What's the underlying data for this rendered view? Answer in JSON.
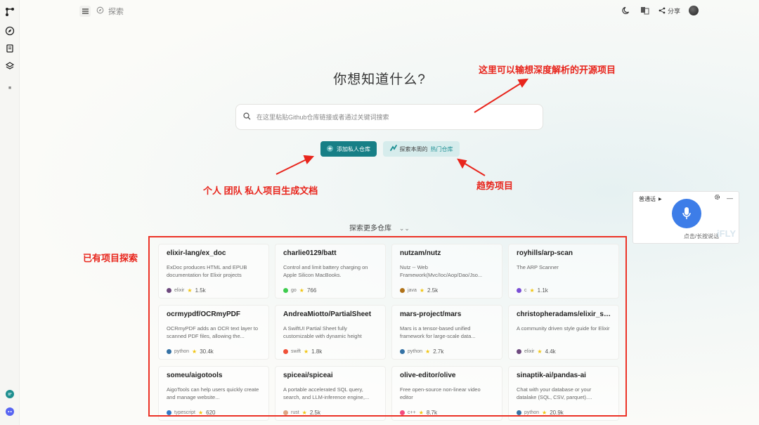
{
  "topbar": {
    "page_label": "探索",
    "share_label": "分享"
  },
  "hero": {
    "title": "你想知道什么?",
    "search_placeholder": "在这里粘贴Github仓库链接或者通过关键词搜索"
  },
  "actions": {
    "add_private_repo": "添加私人仓库",
    "explore_prefix": "探索本周的",
    "explore_highlight": "热门仓库"
  },
  "annotations": {
    "top_right": "这里可以输想深度解析的开源项目",
    "bottom_left": "个人 团队 私人项目生成文档",
    "trend": "趋势项目",
    "existing": "已有项目探索"
  },
  "voice_widget": {
    "mode": "普通话",
    "hint": "点击/长按说话",
    "brand": "iFLY"
  },
  "explore_more": "探索更多仓库",
  "colors": {
    "primary": "#177f86",
    "annotation_red": "#e8251c"
  },
  "repos": [
    {
      "name": "elixir-lang/ex_doc",
      "desc": "ExDoc produces HTML and EPUB documentation for Elixir projects",
      "lang": "elixir",
      "lang_color": "#6e4a7e",
      "stars": "1.5k"
    },
    {
      "name": "charlie0129/batt",
      "desc": "Control and limit battery charging on Apple Silicon MacBooks.",
      "lang": "go",
      "lang_color": "#3fcc4f",
      "stars": "766"
    },
    {
      "name": "nutzam/nutz",
      "desc": "Nutz -- Web Framework(Mvc/Ioc/Aop/Dao/Jso...",
      "lang": "java",
      "lang_color": "#b07219",
      "stars": "2.5k"
    },
    {
      "name": "royhills/arp-scan",
      "desc": "The ARP Scanner",
      "lang": "c",
      "lang_color": "#7b4fd6",
      "stars": "1.1k"
    },
    {
      "name": "ocrmypdf/OCRmyPDF",
      "desc": "OCRmyPDF adds an OCR text layer to scanned PDF files, allowing the...",
      "lang": "python",
      "lang_color": "#3572A5",
      "stars": "30.4k"
    },
    {
      "name": "AndreaMiotto/PartialSheet",
      "desc": "A SwiftUI Partial Sheet fully customizable with dynamic height",
      "lang": "swift",
      "lang_color": "#f05138",
      "stars": "1.8k"
    },
    {
      "name": "mars-project/mars",
      "desc": "Mars is a tensor-based unified framework for large-scale data...",
      "lang": "python",
      "lang_color": "#3572A5",
      "stars": "2.7k"
    },
    {
      "name": "christopheradams/elixir_sty...",
      "desc": "A community driven style guide for Elixir",
      "lang": "elixir",
      "lang_color": "#6e4a7e",
      "stars": "4.4k"
    },
    {
      "name": "someu/aigotools",
      "desc": "AigoTools can help users quickly create and manage website...",
      "lang": "typescript",
      "lang_color": "#3178c6",
      "stars": "620"
    },
    {
      "name": "spiceai/spiceai",
      "desc": "A portable accelerated SQL query, search, and LLM-inference engine,...",
      "lang": "rust",
      "lang_color": "#dea584",
      "stars": "2.5k"
    },
    {
      "name": "olive-editor/olive",
      "desc": "Free open-source non-linear video editor",
      "lang": "c++",
      "lang_color": "#f34b7d",
      "stars": "8.7k"
    },
    {
      "name": "sinaptik-ai/pandas-ai",
      "desc": "Chat with your database or your datalake (SQL, CSV, parquet)....",
      "lang": "python",
      "lang_color": "#3572A5",
      "stars": "20.9k"
    }
  ]
}
